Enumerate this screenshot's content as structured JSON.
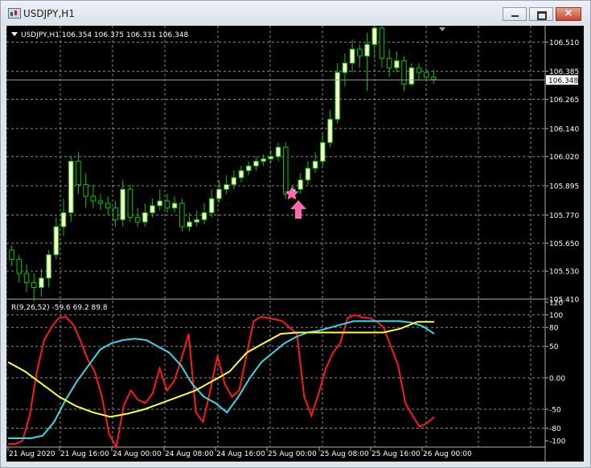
{
  "window": {
    "title": "USDJPY,H1",
    "buttons": {
      "minimize": "minimize",
      "maximize": "maximize",
      "close": "×"
    }
  },
  "price_panel": {
    "info": "USDJPY,H1  106.354 106.375 106.331 106.348",
    "current_price": "106.348",
    "y_ticks": [
      "106.510",
      "106.385",
      "106.265",
      "106.140",
      "106.020",
      "105.895",
      "105.770",
      "105.650",
      "105.530",
      "105.410"
    ]
  },
  "indicator_panel": {
    "info": "R(9,26,52) -59.6 69.2 89.8",
    "y_ticks": [
      "120",
      "100",
      "80",
      "50",
      "0.00",
      "-50",
      "-80",
      "-100"
    ]
  },
  "x_ticks": [
    "21 Aug 2020",
    "21 Aug 16:00",
    "24 Aug 00:00",
    "24 Aug 08:00",
    "24 Aug 16:00",
    "25 Aug 00:00",
    "25 Aug 08:00",
    "25 Aug 16:00",
    "26 Aug 00:00"
  ],
  "colors": {
    "background": "#000000",
    "grid": "#8c8c8c",
    "bull_candle": "#ffffcc",
    "bear_candle": "#000000",
    "candle_wick": "#00c800",
    "signal_marker": "#ff69b4",
    "red_line": "#ff1a1a",
    "cyan_line": "#38d8e8",
    "yellow_line": "#ffff33"
  },
  "signal_icons": [
    "star-icon",
    "up-arrow-icon"
  ],
  "chart_data": [
    {
      "type": "candlestick",
      "title": "USDJPY,H1",
      "ylim": [
        105.41,
        106.58
      ],
      "candles": [
        [
          105.62,
          105.58,
          105.64,
          105.55
        ],
        [
          105.58,
          105.52,
          105.6,
          105.48
        ],
        [
          105.52,
          105.48,
          105.56,
          105.44
        ],
        [
          105.48,
          105.46,
          105.52,
          105.4
        ],
        [
          105.46,
          105.5,
          105.54,
          105.42
        ],
        [
          105.5,
          105.6,
          105.62,
          105.46
        ],
        [
          105.6,
          105.72,
          105.76,
          105.58
        ],
        [
          105.72,
          105.78,
          105.84,
          105.68
        ],
        [
          105.78,
          106.0,
          106.02,
          105.74
        ],
        [
          106.0,
          105.9,
          106.04,
          105.86
        ],
        [
          105.9,
          105.85,
          105.95,
          105.8
        ],
        [
          105.85,
          105.83,
          105.9,
          105.8
        ],
        [
          105.83,
          105.82,
          105.86,
          105.79
        ],
        [
          105.82,
          105.8,
          105.85,
          105.77
        ],
        [
          105.8,
          105.75,
          105.83,
          105.72
        ],
        [
          105.75,
          105.88,
          105.92,
          105.72
        ],
        [
          105.88,
          105.76,
          105.9,
          105.74
        ],
        [
          105.76,
          105.74,
          105.8,
          105.72
        ],
        [
          105.74,
          105.78,
          105.82,
          105.72
        ],
        [
          105.78,
          105.81,
          105.84,
          105.76
        ],
        [
          105.81,
          105.83,
          105.88,
          105.79
        ],
        [
          105.83,
          105.8,
          105.86,
          105.78
        ],
        [
          105.8,
          105.82,
          105.85,
          105.78
        ],
        [
          105.82,
          105.72,
          105.84,
          105.7
        ],
        [
          105.72,
          105.74,
          105.78,
          105.7
        ],
        [
          105.74,
          105.75,
          105.79,
          105.72
        ],
        [
          105.75,
          105.78,
          105.82,
          105.73
        ],
        [
          105.78,
          105.84,
          105.88,
          105.76
        ],
        [
          105.84,
          105.88,
          105.92,
          105.82
        ],
        [
          105.88,
          105.9,
          105.94,
          105.86
        ],
        [
          105.9,
          105.93,
          105.96,
          105.88
        ],
        [
          105.93,
          105.96,
          105.98,
          105.91
        ],
        [
          105.96,
          105.98,
          106.0,
          105.94
        ],
        [
          105.98,
          106.0,
          106.02,
          105.96
        ],
        [
          106.0,
          106.01,
          106.03,
          105.98
        ],
        [
          106.01,
          106.02,
          106.05,
          105.99
        ],
        [
          106.02,
          106.06,
          106.08,
          106.0
        ],
        [
          106.06,
          105.86,
          106.08,
          105.84
        ],
        [
          105.86,
          105.88,
          105.9,
          105.84
        ],
        [
          105.88,
          105.92,
          105.95,
          105.86
        ],
        [
          105.92,
          105.97,
          106.0,
          105.9
        ],
        [
          105.97,
          106.0,
          106.04,
          105.95
        ],
        [
          106.0,
          106.08,
          106.12,
          105.98
        ],
        [
          106.08,
          106.18,
          106.22,
          106.06
        ],
        [
          106.18,
          106.38,
          106.42,
          106.16
        ],
        [
          106.38,
          106.42,
          106.46,
          106.32
        ],
        [
          106.42,
          106.48,
          106.52,
          106.38
        ],
        [
          106.48,
          106.45,
          106.5,
          106.4
        ],
        [
          106.45,
          106.5,
          106.55,
          106.3
        ],
        [
          106.5,
          106.57,
          106.6,
          106.44
        ],
        [
          106.57,
          106.44,
          106.59,
          106.4
        ],
        [
          106.44,
          106.4,
          106.48,
          106.36
        ],
        [
          106.4,
          106.43,
          106.47,
          106.38
        ],
        [
          106.43,
          106.33,
          106.45,
          106.3
        ],
        [
          106.33,
          106.4,
          106.42,
          106.32
        ],
        [
          106.4,
          106.38,
          106.42,
          106.35
        ],
        [
          106.38,
          106.36,
          106.4,
          106.34
        ],
        [
          106.36,
          106.35,
          106.39,
          106.33
        ]
      ],
      "current_price": 106.348
    },
    {
      "type": "line",
      "title": "R(9,26,52)",
      "ylim": [
        -110,
        125
      ],
      "series": [
        {
          "name": "R(9)",
          "values": [
            -105,
            -105,
            -100,
            -60,
            10,
            60,
            80,
            95,
            97,
            85,
            60,
            30,
            10,
            -30,
            -90,
            -110,
            -45,
            -20,
            -35,
            -40,
            -25,
            15,
            -20,
            -5,
            30,
            70,
            -55,
            -70,
            -20,
            35,
            -10,
            -30,
            -20,
            35,
            90,
            97,
            95,
            93,
            90,
            80,
            70,
            -30,
            -60,
            -25,
            15,
            40,
            55,
            95,
            100,
            96,
            95,
            90,
            80,
            50,
            20,
            -40,
            -60,
            -78,
            -72,
            -62
          ]
        },
        {
          "name": "R(26)",
          "values": [
            -96,
            -96,
            -96,
            -92,
            -70,
            -35,
            -5,
            20,
            45,
            55,
            60,
            62,
            60,
            50,
            40,
            20,
            -10,
            -30,
            -40,
            -55,
            -30,
            0,
            25,
            40,
            55,
            65,
            72,
            75,
            80,
            85,
            90,
            90,
            90,
            90,
            90,
            88,
            82,
            70
          ]
        },
        {
          "name": "R(52)",
          "values": [
            25,
            10,
            -10,
            -30,
            -45,
            -55,
            -62,
            -57,
            -50,
            -40,
            -30,
            -20,
            -5,
            10,
            40,
            55,
            70,
            72,
            72,
            72,
            72,
            72,
            72,
            78,
            89,
            89
          ]
        }
      ]
    }
  ]
}
